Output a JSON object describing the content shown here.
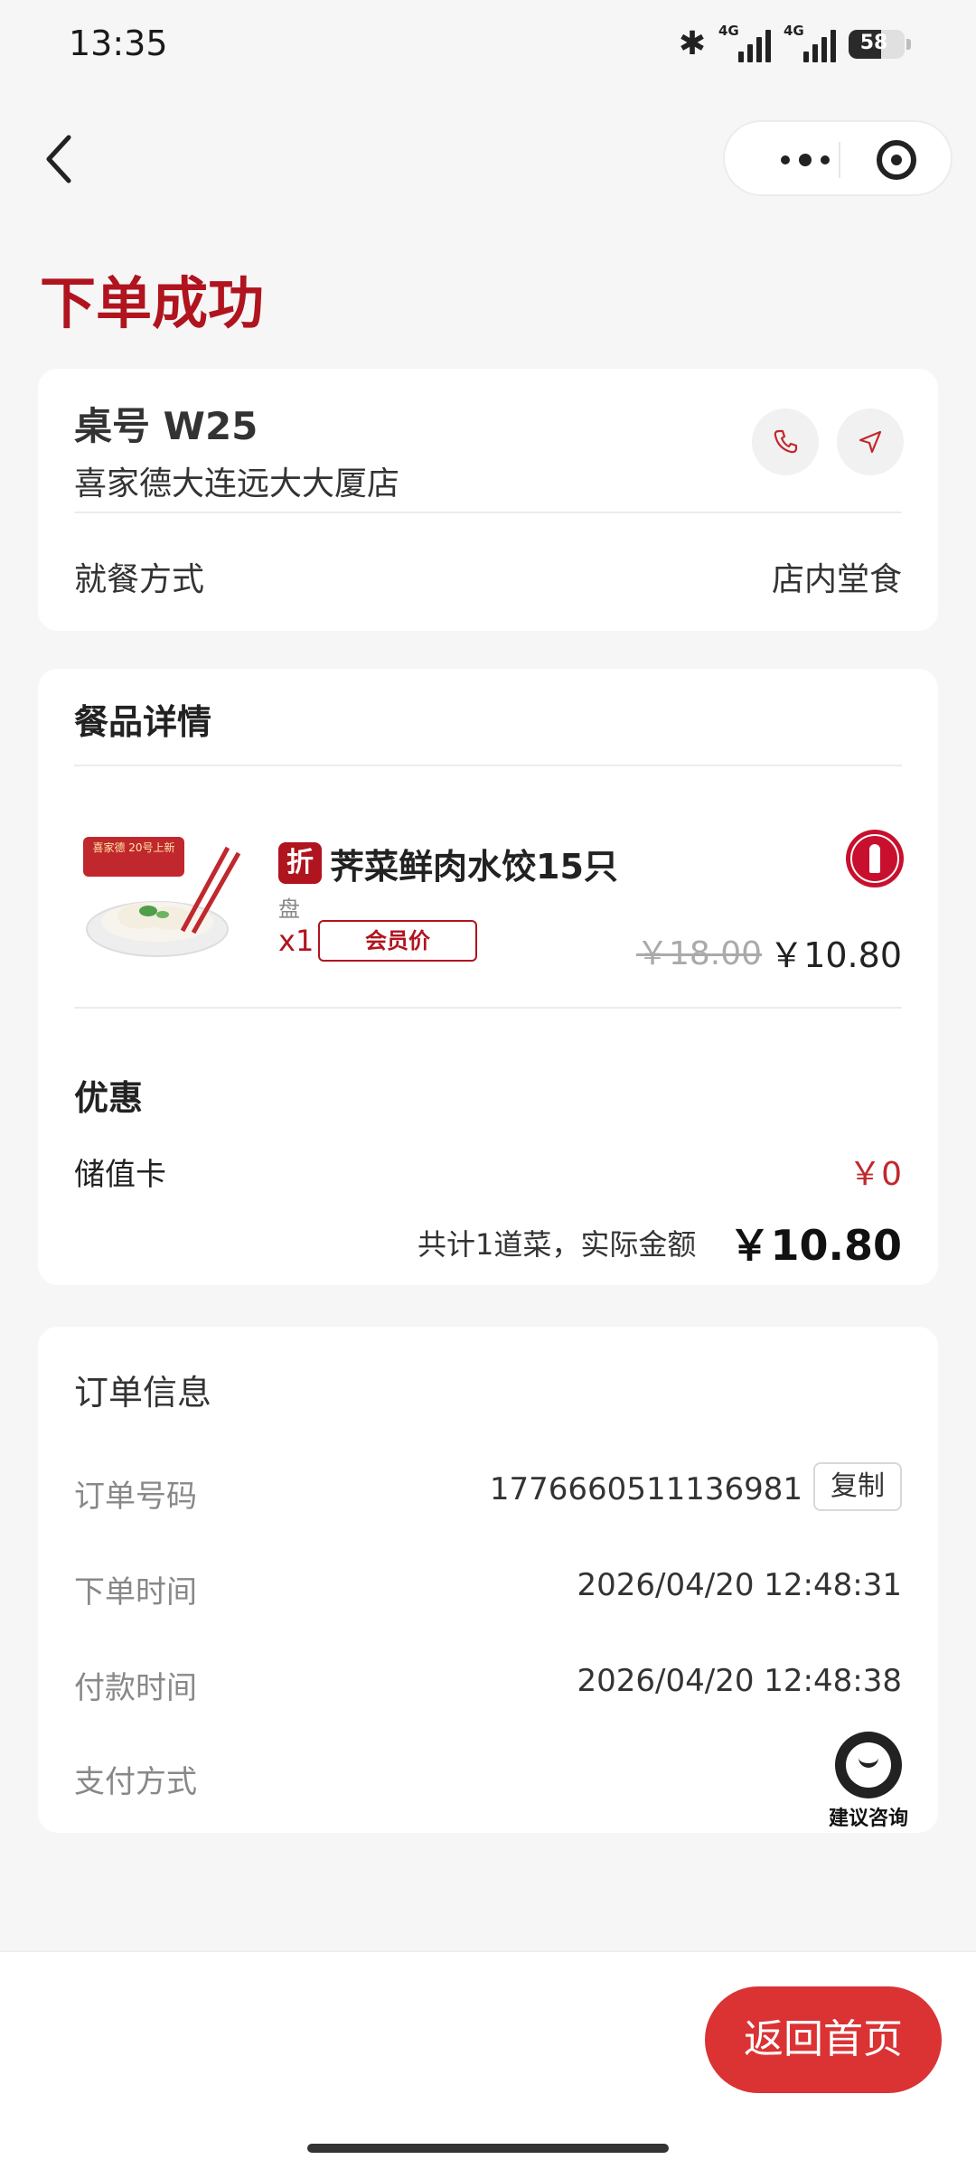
{
  "status_bar": {
    "time": "13:35",
    "network_1": "4G",
    "network_2": "4G",
    "battery": "58",
    "battery_level": 0.58,
    "icons": [
      "bluetooth-icon",
      "signal-icon",
      "signal-icon",
      "battery-icon"
    ]
  },
  "nav": {
    "icons": [
      "back-arrow-icon",
      "more-dots-icon",
      "target-icon"
    ]
  },
  "page": {
    "title": "下单成功"
  },
  "table_card": {
    "table_no": "桌号 W25",
    "store_name": "喜家德大连远大大厦店",
    "icons": [
      "phone-icon",
      "navigation-icon"
    ],
    "dine_label": "就餐方式",
    "dine_value": "店内堂食"
  },
  "items_card": {
    "title": "餐品详情",
    "items": [
      {
        "badge": "折",
        "name": "荠菜鲜肉水饺15只",
        "unit": "盘",
        "qty": "x1",
        "member_tag": "会员价",
        "original_price": "￥18.00",
        "price": "￥10.80",
        "image_text": "喜家德 20号上新"
      }
    ],
    "discount_title": "优惠",
    "stored_card_label": "储值卡",
    "stored_card_value": "￥0",
    "total_text": "共计1道菜，实际金额",
    "total_amount": "￥10.80"
  },
  "order_card": {
    "title": "订单信息",
    "order_no_label": "订单号码",
    "order_no": "1776660511136981",
    "copy_label": "复制",
    "order_time_label": "下单时间",
    "order_time": "2026/04/20 12:48:31",
    "pay_time_label": "付款时间",
    "pay_time": "2026/04/20 12:48:38",
    "pay_method_label": "支付方式",
    "pay_method": ""
  },
  "support": {
    "label": "建议咨询"
  },
  "bottom": {
    "home_button": "返回首页"
  },
  "colors": {
    "brand_red": "#b0141e",
    "button_red": "#db3233",
    "background": "#f6f6f6"
  }
}
